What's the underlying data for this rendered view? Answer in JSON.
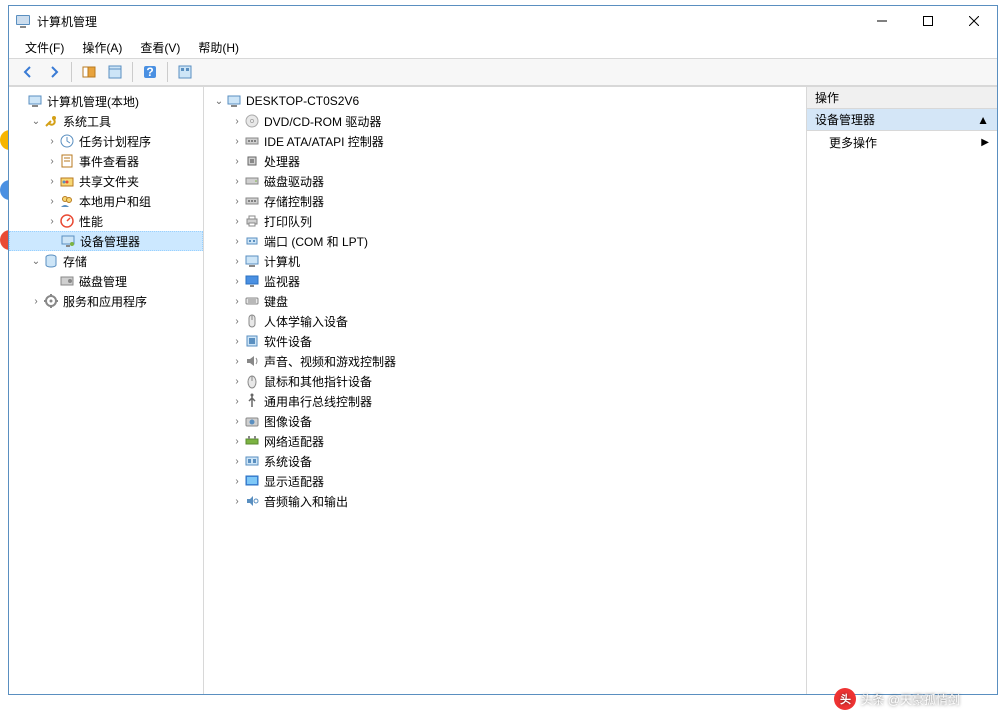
{
  "window": {
    "title": "计算机管理"
  },
  "menubar": [
    {
      "label": "文件(F)"
    },
    {
      "label": "操作(A)"
    },
    {
      "label": "查看(V)"
    },
    {
      "label": "帮助(H)"
    }
  ],
  "left_tree": {
    "root": {
      "label": "计算机管理(本地)"
    },
    "groups": [
      {
        "label": "系统工具",
        "expanded": true,
        "children": [
          {
            "label": "任务计划程序",
            "has_child": true
          },
          {
            "label": "事件查看器",
            "has_child": true
          },
          {
            "label": "共享文件夹",
            "has_child": true
          },
          {
            "label": "本地用户和组",
            "has_child": true
          },
          {
            "label": "性能",
            "has_child": true
          },
          {
            "label": "设备管理器",
            "has_child": false,
            "selected": true
          }
        ]
      },
      {
        "label": "存储",
        "expanded": true,
        "children": [
          {
            "label": "磁盘管理",
            "has_child": false
          }
        ]
      },
      {
        "label": "服务和应用程序",
        "expanded": false,
        "children": []
      }
    ]
  },
  "mid_tree": {
    "root": {
      "label": "DESKTOP-CT0S2V6"
    },
    "children": [
      {
        "label": "DVD/CD-ROM 驱动器"
      },
      {
        "label": "IDE ATA/ATAPI 控制器"
      },
      {
        "label": "处理器"
      },
      {
        "label": "磁盘驱动器"
      },
      {
        "label": "存储控制器"
      },
      {
        "label": "打印队列"
      },
      {
        "label": "端口 (COM 和 LPT)"
      },
      {
        "label": "计算机"
      },
      {
        "label": "监视器"
      },
      {
        "label": "键盘"
      },
      {
        "label": "人体学输入设备"
      },
      {
        "label": "软件设备"
      },
      {
        "label": "声音、视频和游戏控制器"
      },
      {
        "label": "鼠标和其他指针设备"
      },
      {
        "label": "通用串行总线控制器"
      },
      {
        "label": "图像设备"
      },
      {
        "label": "网络适配器"
      },
      {
        "label": "系统设备"
      },
      {
        "label": "显示适配器"
      },
      {
        "label": "音频输入和输出"
      }
    ]
  },
  "right_panel": {
    "header": "操作",
    "section": "设备管理器",
    "more": "更多操作"
  },
  "watermark": "头条 @天豪孤情剑"
}
